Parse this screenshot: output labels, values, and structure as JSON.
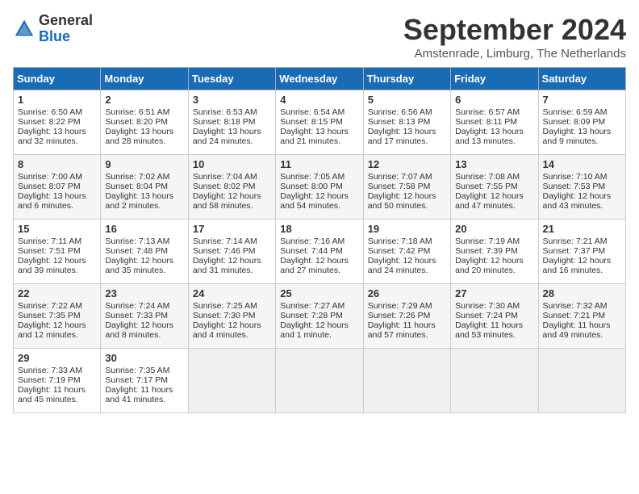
{
  "header": {
    "logo_general": "General",
    "logo_blue": "Blue",
    "month_title": "September 2024",
    "location": "Amstenrade, Limburg, The Netherlands"
  },
  "days_of_week": [
    "Sunday",
    "Monday",
    "Tuesday",
    "Wednesday",
    "Thursday",
    "Friday",
    "Saturday"
  ],
  "weeks": [
    [
      {
        "day": "1",
        "info": "Sunrise: 6:50 AM\nSunset: 8:22 PM\nDaylight: 13 hours\nand 32 minutes."
      },
      {
        "day": "2",
        "info": "Sunrise: 6:51 AM\nSunset: 8:20 PM\nDaylight: 13 hours\nand 28 minutes."
      },
      {
        "day": "3",
        "info": "Sunrise: 6:53 AM\nSunset: 8:18 PM\nDaylight: 13 hours\nand 24 minutes."
      },
      {
        "day": "4",
        "info": "Sunrise: 6:54 AM\nSunset: 8:15 PM\nDaylight: 13 hours\nand 21 minutes."
      },
      {
        "day": "5",
        "info": "Sunrise: 6:56 AM\nSunset: 8:13 PM\nDaylight: 13 hours\nand 17 minutes."
      },
      {
        "day": "6",
        "info": "Sunrise: 6:57 AM\nSunset: 8:11 PM\nDaylight: 13 hours\nand 13 minutes."
      },
      {
        "day": "7",
        "info": "Sunrise: 6:59 AM\nSunset: 8:09 PM\nDaylight: 13 hours\nand 9 minutes."
      }
    ],
    [
      {
        "day": "8",
        "info": "Sunrise: 7:00 AM\nSunset: 8:07 PM\nDaylight: 13 hours\nand 6 minutes."
      },
      {
        "day": "9",
        "info": "Sunrise: 7:02 AM\nSunset: 8:04 PM\nDaylight: 13 hours\nand 2 minutes."
      },
      {
        "day": "10",
        "info": "Sunrise: 7:04 AM\nSunset: 8:02 PM\nDaylight: 12 hours\nand 58 minutes."
      },
      {
        "day": "11",
        "info": "Sunrise: 7:05 AM\nSunset: 8:00 PM\nDaylight: 12 hours\nand 54 minutes."
      },
      {
        "day": "12",
        "info": "Sunrise: 7:07 AM\nSunset: 7:58 PM\nDaylight: 12 hours\nand 50 minutes."
      },
      {
        "day": "13",
        "info": "Sunrise: 7:08 AM\nSunset: 7:55 PM\nDaylight: 12 hours\nand 47 minutes."
      },
      {
        "day": "14",
        "info": "Sunrise: 7:10 AM\nSunset: 7:53 PM\nDaylight: 12 hours\nand 43 minutes."
      }
    ],
    [
      {
        "day": "15",
        "info": "Sunrise: 7:11 AM\nSunset: 7:51 PM\nDaylight: 12 hours\nand 39 minutes."
      },
      {
        "day": "16",
        "info": "Sunrise: 7:13 AM\nSunset: 7:48 PM\nDaylight: 12 hours\nand 35 minutes."
      },
      {
        "day": "17",
        "info": "Sunrise: 7:14 AM\nSunset: 7:46 PM\nDaylight: 12 hours\nand 31 minutes."
      },
      {
        "day": "18",
        "info": "Sunrise: 7:16 AM\nSunset: 7:44 PM\nDaylight: 12 hours\nand 27 minutes."
      },
      {
        "day": "19",
        "info": "Sunrise: 7:18 AM\nSunset: 7:42 PM\nDaylight: 12 hours\nand 24 minutes."
      },
      {
        "day": "20",
        "info": "Sunrise: 7:19 AM\nSunset: 7:39 PM\nDaylight: 12 hours\nand 20 minutes."
      },
      {
        "day": "21",
        "info": "Sunrise: 7:21 AM\nSunset: 7:37 PM\nDaylight: 12 hours\nand 16 minutes."
      }
    ],
    [
      {
        "day": "22",
        "info": "Sunrise: 7:22 AM\nSunset: 7:35 PM\nDaylight: 12 hours\nand 12 minutes."
      },
      {
        "day": "23",
        "info": "Sunrise: 7:24 AM\nSunset: 7:33 PM\nDaylight: 12 hours\nand 8 minutes."
      },
      {
        "day": "24",
        "info": "Sunrise: 7:25 AM\nSunset: 7:30 PM\nDaylight: 12 hours\nand 4 minutes."
      },
      {
        "day": "25",
        "info": "Sunrise: 7:27 AM\nSunset: 7:28 PM\nDaylight: 12 hours\nand 1 minute."
      },
      {
        "day": "26",
        "info": "Sunrise: 7:29 AM\nSunset: 7:26 PM\nDaylight: 11 hours\nand 57 minutes."
      },
      {
        "day": "27",
        "info": "Sunrise: 7:30 AM\nSunset: 7:24 PM\nDaylight: 11 hours\nand 53 minutes."
      },
      {
        "day": "28",
        "info": "Sunrise: 7:32 AM\nSunset: 7:21 PM\nDaylight: 11 hours\nand 49 minutes."
      }
    ],
    [
      {
        "day": "29",
        "info": "Sunrise: 7:33 AM\nSunset: 7:19 PM\nDaylight: 11 hours\nand 45 minutes."
      },
      {
        "day": "30",
        "info": "Sunrise: 7:35 AM\nSunset: 7:17 PM\nDaylight: 11 hours\nand 41 minutes."
      },
      {
        "day": "",
        "info": ""
      },
      {
        "day": "",
        "info": ""
      },
      {
        "day": "",
        "info": ""
      },
      {
        "day": "",
        "info": ""
      },
      {
        "day": "",
        "info": ""
      }
    ]
  ]
}
